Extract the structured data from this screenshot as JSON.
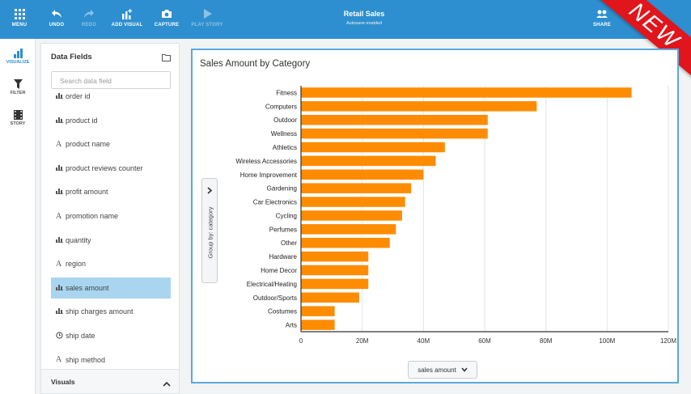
{
  "toolbar": {
    "menu_label": "MENU",
    "undo_label": "UNDO",
    "redo_label": "REDO",
    "add_visual_label": "ADD VISUAL",
    "capture_label": "CAPTURE",
    "play_story_label": "PLAY STORY",
    "share_label": "SHARE",
    "title": "Retail Sales",
    "subtitle": "Autosave enabled",
    "ribbon_text": "NEW"
  },
  "rail": {
    "visualize_label": "VISUALIZE",
    "filter_label": "FILTER",
    "story_label": "STORY"
  },
  "fields_panel": {
    "title": "Data Fields",
    "search_placeholder": "Search data field",
    "items": [
      {
        "type_icon": "measure-icon",
        "label": "order id"
      },
      {
        "type_icon": "measure-icon",
        "label": "product id"
      },
      {
        "type_icon": "text-icon",
        "label": "product name"
      },
      {
        "type_icon": "measure-icon",
        "label": "product reviews counter"
      },
      {
        "type_icon": "measure-icon",
        "label": "profit amount"
      },
      {
        "type_icon": "text-icon",
        "label": "promotion name"
      },
      {
        "type_icon": "measure-icon",
        "label": "quantity"
      },
      {
        "type_icon": "text-icon",
        "label": "region"
      },
      {
        "type_icon": "measure-icon",
        "label": "sales amount",
        "selected": true
      },
      {
        "type_icon": "measure-icon",
        "label": "ship charges amount"
      },
      {
        "type_icon": "date-icon",
        "label": "ship date"
      },
      {
        "type_icon": "text-icon",
        "label": "ship method"
      }
    ],
    "visuals_label": "Visuals"
  },
  "visual": {
    "title": "Sales Amount by Category",
    "group_by_label": "Group by: category",
    "x_axis_button": "sales amount"
  },
  "chart_data": {
    "type": "bar",
    "orientation": "horizontal",
    "title": "Sales Amount by Category",
    "categories": [
      "Fitness",
      "Computers",
      "Outdoor",
      "Wellness",
      "Athletics",
      "Wireless Accessories",
      "Home Improvement",
      "Gardening",
      "Car Electronics",
      "Cycling",
      "Perfumes",
      "Other",
      "Hardware",
      "Home Decor",
      "Electrical/Heating",
      "Outdoor/Sports",
      "Costumes",
      "Arts"
    ],
    "values": [
      108,
      77,
      61,
      61,
      47,
      44,
      40,
      36,
      34,
      33,
      31,
      29,
      22,
      22,
      22,
      19,
      11,
      11
    ],
    "value_unit": "M",
    "xlim": [
      0,
      120
    ],
    "xticks": [
      "0",
      "20M",
      "40M",
      "60M",
      "80M",
      "100M",
      "120M"
    ],
    "xlabel": "sales amount",
    "ylabel": "Group by: category",
    "bar_color": "#ff8c00",
    "grid": true
  },
  "colors": {
    "accent": "#2d8fcf",
    "selection": "#a9d5f1",
    "bar": "#ff8c00",
    "ribbon": "#e0161c"
  }
}
